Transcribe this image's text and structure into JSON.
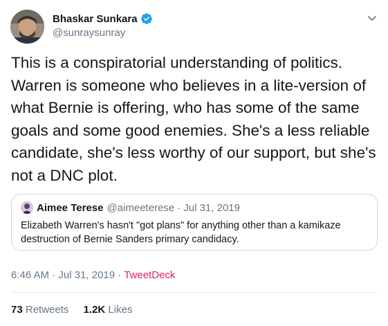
{
  "author": {
    "name": "Bhaskar Sunkara",
    "handle": "@sunraysunray"
  },
  "tweet": {
    "text": "This is a conspiratorial understanding of politics. Warren is someone who believes in a lite-version of what Bernie is offering, who has some of the same goals and some good enemies. She's a less reliable candidate, she's less worthy of our support, but she's not a DNC plot."
  },
  "quote": {
    "name": "Aimee Terese",
    "handle": "@aimeeterese",
    "separator": "·",
    "date": "Jul 31, 2019",
    "text": "Elizabeth Warren's hasn't \"got plans\" for anything other than a kamikaze destruction of Bernie Sanders primary candidacy."
  },
  "meta": {
    "time": "6:46 AM",
    "separator1": " · ",
    "date": "Jul 31, 2019",
    "separator2": " · ",
    "source": "TweetDeck"
  },
  "stats": {
    "retweets_count": "73",
    "retweets_label": "Retweets",
    "likes_count": "1.2K",
    "likes_label": "Likes"
  },
  "colors": {
    "verified": "#1da1f2",
    "source_link": "#e0245e",
    "secondary_text": "#657786"
  },
  "icons": {
    "verified": "verified-badge-icon",
    "caret": "chevron-down-icon"
  }
}
